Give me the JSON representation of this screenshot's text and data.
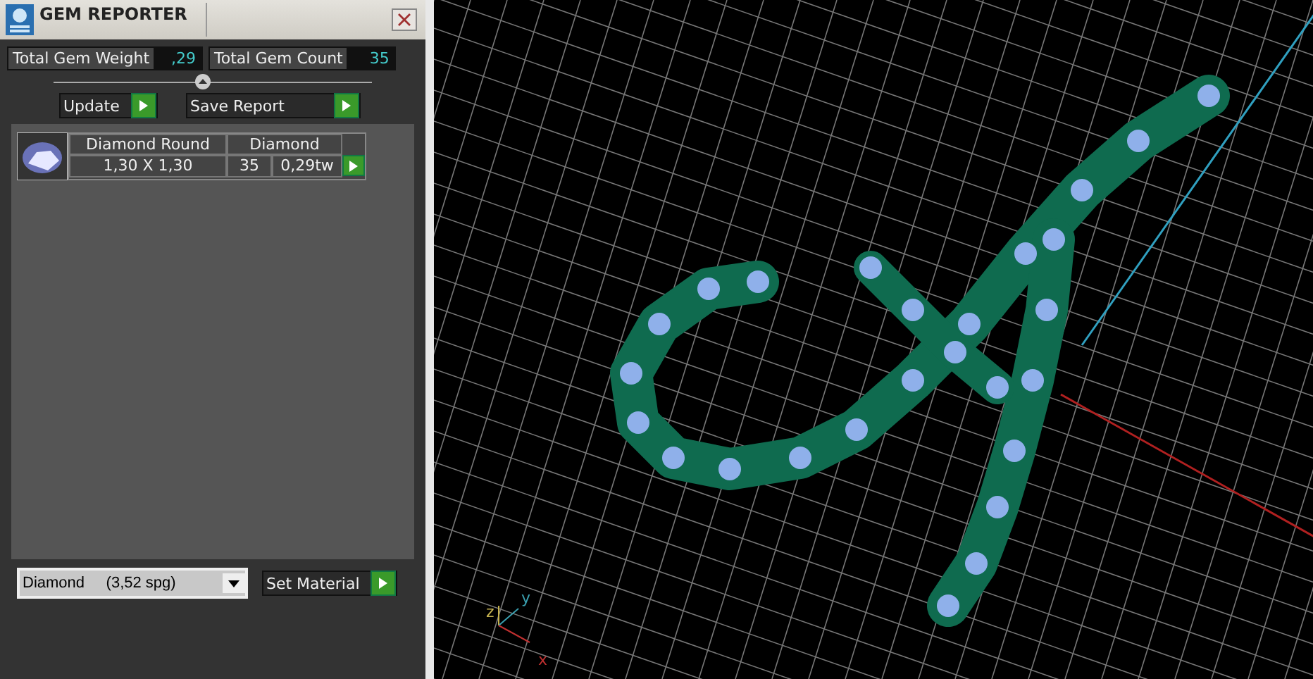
{
  "window": {
    "title": "GEM REPORTER"
  },
  "totals": [
    {
      "label": "Total Gem Weight",
      "value": ",29"
    },
    {
      "label": "Total Gem Count",
      "value": "35"
    }
  ],
  "actions": [
    {
      "label": "Update"
    },
    {
      "label": "Save Report"
    }
  ],
  "gems": [
    {
      "name": "Diamond Round",
      "material": "Diamond",
      "size": "1,30 X 1,30",
      "count": "35",
      "weight": "0,29tw"
    }
  ],
  "material_select": {
    "value": "Diamond     (3,52 spg)"
  },
  "set_material": {
    "label": "Set Material"
  },
  "viewport": {
    "axes": [
      {
        "label": "z",
        "color": "#c8b450"
      },
      {
        "label": "y",
        "color": "#3aa0b0"
      },
      {
        "label": "x",
        "color": "#c03030"
      }
    ]
  }
}
